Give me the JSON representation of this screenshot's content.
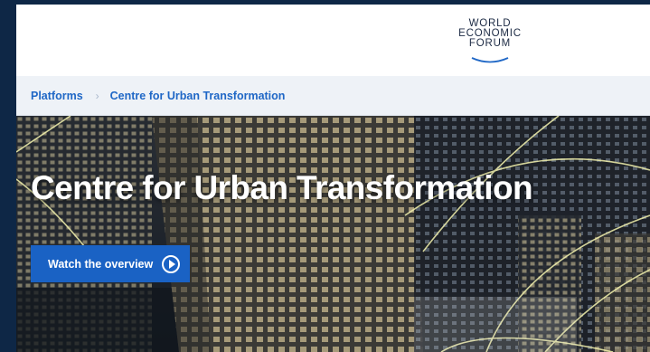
{
  "logo": {
    "lines": [
      "WORLD",
      "ECONOMIC",
      "FORUM"
    ]
  },
  "breadcrumb": {
    "items": [
      "Platforms",
      "Centre for Urban Transformation"
    ],
    "separator": "›"
  },
  "hero": {
    "title": "Centre for Urban Transformation",
    "button_label": "Watch the overview"
  },
  "icons": {
    "play": "play-circle-icon",
    "logo_swoosh": "swoosh-icon"
  },
  "colors": {
    "link_blue": "#1f67c6",
    "button_blue": "#1a62c4",
    "page_bg": "#0e2746"
  }
}
